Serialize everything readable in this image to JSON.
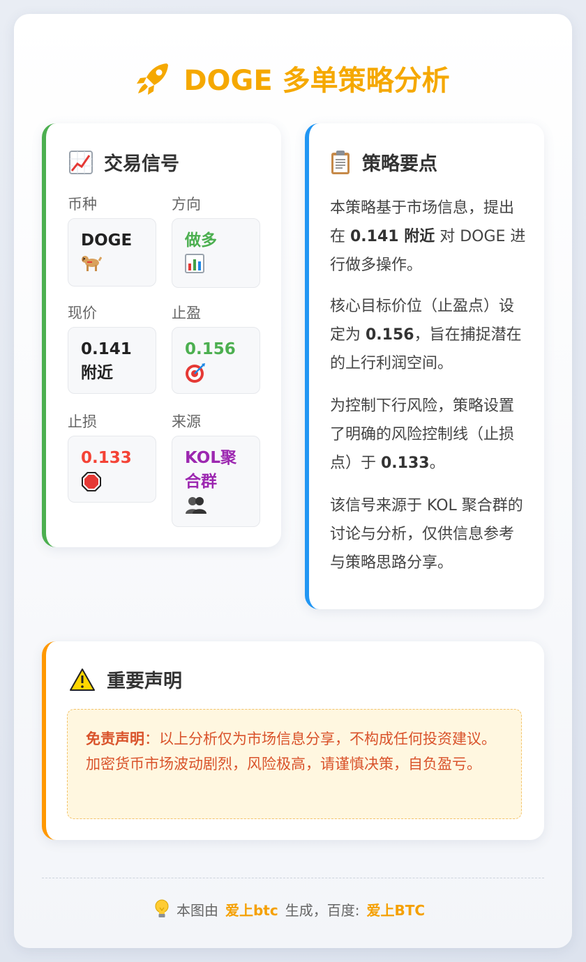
{
  "title": "DOGE 多单策略分析",
  "signal": {
    "header": "交易信号",
    "fields": [
      {
        "label": "币种",
        "value": "DOGE",
        "icon": "dog-icon",
        "color": "#222222"
      },
      {
        "label": "方向",
        "value": "做多",
        "icon": "bar-chart-icon",
        "color": "#4caf50"
      },
      {
        "label": "现价",
        "value": "0.141 附近",
        "color": "#222222"
      },
      {
        "label": "止盈",
        "value": "0.156",
        "icon": "target-icon",
        "color": "#4caf50"
      },
      {
        "label": "止损",
        "value": "0.133",
        "icon": "stop-sign-icon",
        "color": "#f44336"
      },
      {
        "label": "来源",
        "value": "KOL聚合群",
        "icon": "people-icon",
        "color": "#9c27b0"
      }
    ]
  },
  "strategy": {
    "header": "策略要点",
    "p1_a": "本策略基于市场信息，提出在 ",
    "p1_b": "0.141 附近",
    "p1_c": " 对 DOGE 进行做多操作。",
    "p2_a": "核心目标价位（止盈点）设定为 ",
    "p2_b": "0.156",
    "p2_c": "，旨在捕捉潜在的上行利润空间。",
    "p3_a": "为控制下行风险，策略设置了明确的风险控制线（止损点）于 ",
    "p3_b": "0.133",
    "p3_c": "。",
    "p4": "该信号来源于 KOL 聚合群的讨论与分析，仅供信息参考与策略思路分享。"
  },
  "notice": {
    "header": "重要声明",
    "label": "免责声明",
    "text": "：以上分析仅为市场信息分享，不构成任何投资建议。加密货币市场波动剧烈，风险极高，请谨慎决策，自负盈亏。"
  },
  "footer": {
    "prefix": "本图由",
    "brand": "爱上btc",
    "middle": "生成，百度:",
    "site": "爱上BTC"
  },
  "colors": {
    "accent": "#f5a800",
    "signal_border": "#4caf50",
    "strategy_border": "#2196f3",
    "notice_border": "#ff9800"
  }
}
